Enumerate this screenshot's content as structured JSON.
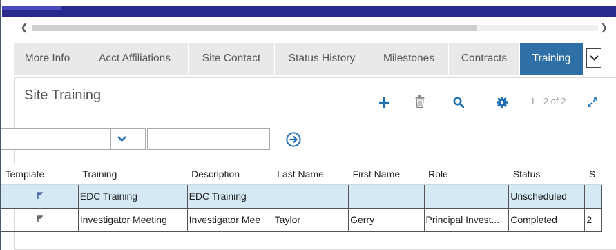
{
  "scroll": {
    "left_icon": "chevron-left-icon",
    "right_icon": "chevron-right-icon"
  },
  "tabs": [
    {
      "label": "More Info",
      "active": false
    },
    {
      "label": "Acct Affiliations",
      "active": false
    },
    {
      "label": "Site Contact",
      "active": false
    },
    {
      "label": "Status History",
      "active": false
    },
    {
      "label": "Milestones",
      "active": false
    },
    {
      "label": "Contracts",
      "active": false
    },
    {
      "label": "Training",
      "active": true
    }
  ],
  "panel": {
    "title": "Site Training",
    "pager": "1 - 2 of 2",
    "icons": [
      "plus-icon",
      "trash-icon",
      "search-icon",
      "gear-icon",
      "expand-icon"
    ]
  },
  "filter": {
    "field_value": "",
    "text_value": ""
  },
  "table": {
    "columns": [
      "Template",
      "Training",
      "Description",
      "Last Name",
      "First Name",
      "Role",
      "Status",
      "S"
    ],
    "rows": [
      {
        "template_icon": "flag-icon",
        "training": "EDC Training",
        "description": "EDC Training",
        "last_name": "",
        "first_name": "",
        "role": "",
        "status": "Unscheduled",
        "extra": "",
        "selected": true
      },
      {
        "template_icon": "flag-icon",
        "training": "Investigator Meeting",
        "description": "Investigator Mee",
        "last_name": "Taylor",
        "first_name": "Gerry",
        "role": "Principal Invest...",
        "status": "Completed",
        "extra": "2",
        "selected": false
      }
    ]
  },
  "colors": {
    "accent": "#2a2a8c",
    "active_tab": "#2e6fa6",
    "selected_row": "#d5e9f5",
    "toolbar_icon": "#1f6fb2"
  }
}
